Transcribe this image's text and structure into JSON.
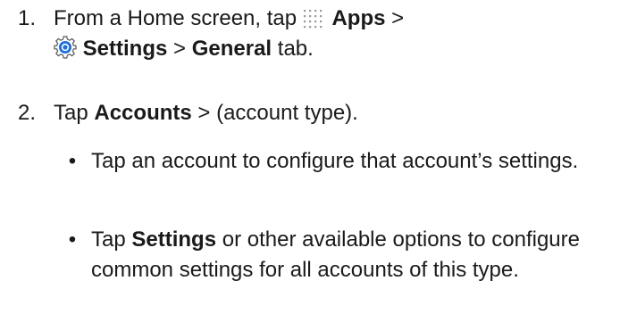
{
  "steps": [
    {
      "number": "1.",
      "prefix": "From a Home screen, tap",
      "apps_label": "Apps",
      "sep1": " >",
      "settings_label": "Settings",
      "sep2": " > ",
      "general_label": "General",
      "suffix": " tab."
    },
    {
      "number": "2.",
      "prefix": "Tap ",
      "accounts_label": "Accounts",
      "suffix": " > (account type)."
    }
  ],
  "bullets": [
    {
      "symbol": "•",
      "text": "Tap an account to configure that account’s settings."
    },
    {
      "symbol": "•",
      "prefix": "Tap ",
      "settings_label": "Settings",
      "suffix": " or other available options to configure common settings for all accounts of this type."
    }
  ],
  "icons": {
    "apps": "apps-grid-icon",
    "settings": "settings-gear-icon",
    "settings_color": "#1e6fd9"
  }
}
